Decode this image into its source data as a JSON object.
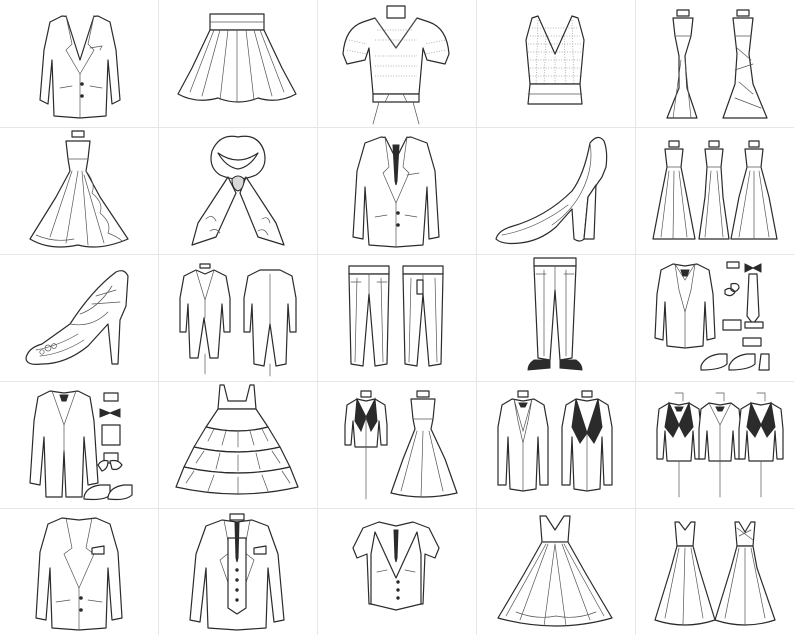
{
  "sheet": {
    "background": "#ffffff",
    "line_color": "#2b2b2b",
    "rows": [
      [
        "suit-jacket-icon",
        "flared-skirt-icon",
        "lace-blouse-icon",
        "lace-crop-top-icon",
        "evening-gowns-icon"
      ],
      [
        "ruffled-gown-icon",
        "silk-scarf-icon",
        "two-piece-suit-icon",
        "high-heel-pump-icon",
        "three-dresses-icon"
      ],
      [
        "strappy-heel-sandal-icon",
        "tailcoat-front-back-icon",
        "trousers-front-back-icon",
        "trousers-with-shoes-icon",
        "groom-outfit-set-icon"
      ],
      [
        "morning-coat-set-icon",
        "tiered-ruffle-dress-icon",
        "tux-and-dress-icon",
        "two-tuxedos-icon",
        "three-tuxedos-icon"
      ],
      [
        "blazer-icon",
        "three-piece-suit-icon",
        "waistcoat-shirt-icon",
        "ball-gown-icon",
        "two-wedding-gowns-icon"
      ]
    ]
  }
}
